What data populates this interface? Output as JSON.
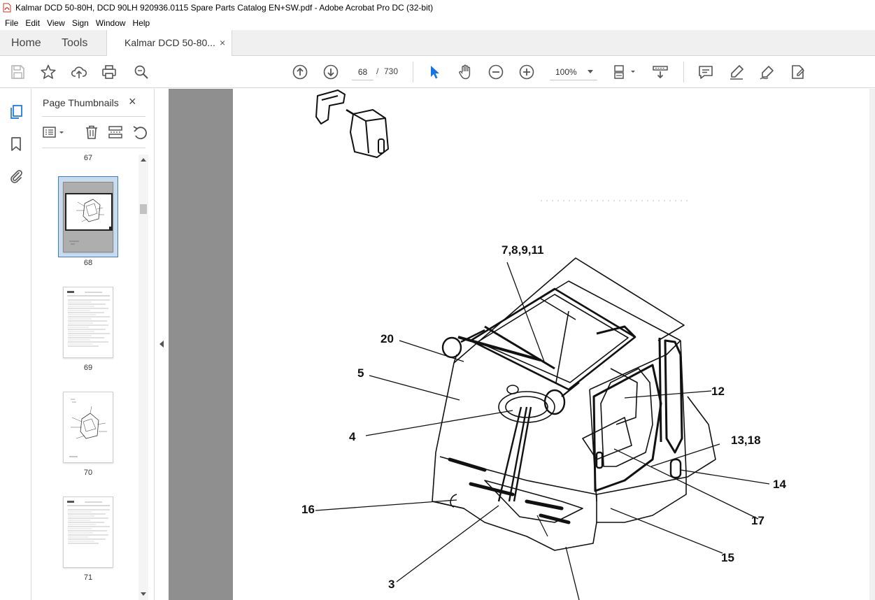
{
  "window": {
    "title": "Kalmar DCD 50-80H, DCD 90LH 920936.0115 Spare Parts Catalog EN+SW.pdf - Adobe Acrobat Pro DC (32-bit)"
  },
  "menu": [
    "File",
    "Edit",
    "View",
    "Sign",
    "Window",
    "Help"
  ],
  "tabs": {
    "home": "Home",
    "tools": "Tools",
    "document": "Kalmar DCD 50-80...",
    "close_glyph": "×"
  },
  "toolbar": {
    "page_current": "68",
    "page_separator": "/",
    "page_total": "730",
    "zoom": "100%"
  },
  "thumbnails_panel": {
    "title": "Page Thumbnails",
    "close_glyph": "×",
    "pages": [
      "67",
      "68",
      "69",
      "70",
      "71"
    ],
    "selected_page": "68"
  },
  "drawing": {
    "callouts": [
      "7,8,9,11",
      "20",
      "5",
      "4",
      "12",
      "13,18",
      "14",
      "16",
      "17",
      "15",
      "3"
    ]
  },
  "colors": {
    "accent": "#1473e6",
    "doc_background": "#8f8f8f",
    "selected_thumb": "#c9dced"
  },
  "icons": {
    "rail": [
      "page-thumbnails-icon",
      "bookmark-icon",
      "attachment-icon"
    ],
    "left_tools": [
      "save-icon",
      "star-icon",
      "upload-icon",
      "print-icon",
      "find-icon"
    ],
    "nav_tools": [
      "prev-page-icon",
      "next-page-icon",
      "select-cursor-icon",
      "hand-icon",
      "zoom-out-icon",
      "zoom-in-icon",
      "page-fit-icon",
      "scroll-mode-icon"
    ],
    "right_tools": [
      "comment-icon",
      "highlight-icon",
      "sign-icon",
      "fill-sign-icon"
    ]
  }
}
